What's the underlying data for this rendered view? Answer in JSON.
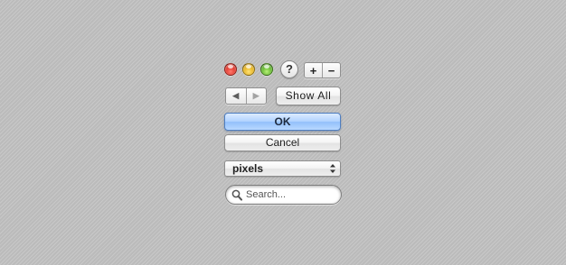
{
  "window_controls": {
    "close": {
      "icon": "close-icon",
      "color": "#e0362a"
    },
    "minimize": {
      "icon": "minimize-icon",
      "color": "#e6b31c"
    },
    "zoom": {
      "icon": "zoom-icon",
      "color": "#5fb52a"
    }
  },
  "help_button": {
    "label": "?"
  },
  "add_remove": {
    "add_label": "+",
    "remove_label": "−"
  },
  "navigation": {
    "back_icon": "◀",
    "forward_icon": "▶"
  },
  "show_all_button": {
    "label": "Show All"
  },
  "ok_button": {
    "label": "OK",
    "accent": "#93c0fb"
  },
  "cancel_button": {
    "label": "Cancel"
  },
  "units_popup": {
    "selected": "pixels"
  },
  "search": {
    "placeholder": "Search...",
    "value": ""
  }
}
